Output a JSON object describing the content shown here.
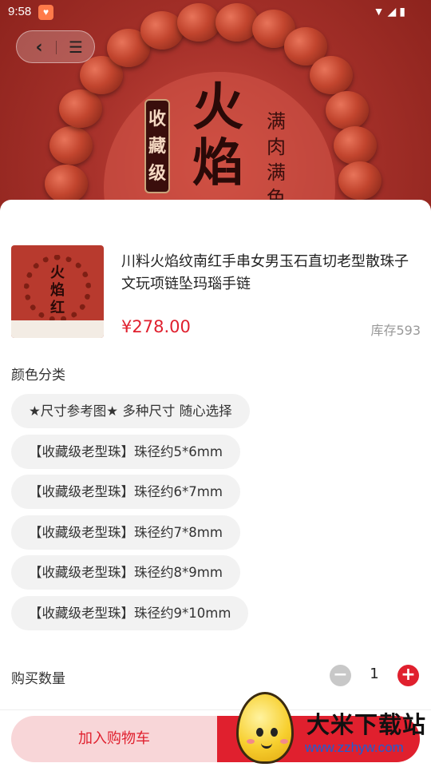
{
  "status_bar": {
    "time": "9:58"
  },
  "hero": {
    "stamp_text": "收藏级",
    "calligraphy": "火焰",
    "vertical_text": "满肉满色"
  },
  "product": {
    "title": "川料火焰纹南红手串女男玉石直切老型散珠子文玩项链坠玛瑙手链",
    "price": "¥278.00",
    "stock": "库存593",
    "thumb_calligraphy": "火焰红"
  },
  "spec": {
    "label": "颜色分类",
    "options": [
      "★尺寸参考图★ 多种尺寸 随心选择",
      "【收藏级老型珠】珠径约5*6mm",
      "【收藏级老型珠】珠径约6*7mm",
      "【收藏级老型珠】珠径约7*8mm",
      "【收藏级老型珠】珠径约8*9mm",
      "【收藏级老型珠】珠径约9*10mm"
    ]
  },
  "quantity": {
    "label": "购买数量",
    "value": "1"
  },
  "actions": {
    "add_to_cart": "加入购物车"
  },
  "watermark": {
    "name": "大米下载站",
    "url": "www.zzhyw.com"
  },
  "colors": {
    "accent": "#e0202e",
    "cart_bg": "#f8d6d8",
    "option_bg": "#f2f2f2"
  }
}
